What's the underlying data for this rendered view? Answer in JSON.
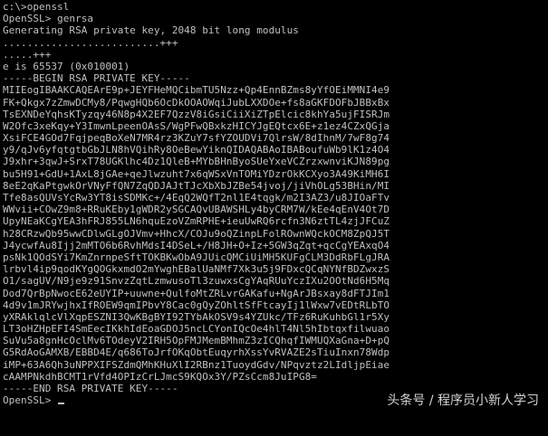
{
  "terminal": {
    "lines": [
      "c:\\>openssl",
      "OpenSSL> genrsa",
      "Generating RSA private key, 2048 bit long modulus",
      "..........................+++",
      ".....+++",
      "e is 65537 (0x010001)",
      "-----BEGIN RSA PRIVATE KEY-----",
      "MIIEogIBAAKCAQEArE9p+JEYFHeMQCibmTU5Nzz+Qp4EnnBZms8yYfOEiMMNI4e9",
      "FK+Qkgx7zZmwDCMy8/PqwgHQb6OcDkOOAOWqiJubLXXDOe+fs8aGKFDOFbJBBxBx",
      "TsEXNDeYqhsKTyzqy46N8p4X2EF7QzzV8iGsiCiiXiZTpElcic8khYa5ujFISRJm",
      "W2Ofc3xeKqy+Y3ImwnLpeenOAsS/WgPFwQBxkzHICYJgEQtcx6E+z1ez4CZxQGja",
      "XsiFCE4GOd7FqjpeqBoXeN7MR4rz3KZuY7sfYZOUDVi7QlrsW/8dIhnM/7wF8g74",
      "y9/qJv6yfqtgtbGbJLN8hVQihRy8OeBewYiknQIDAQABAoIBABoufuWb9lK1z4O4",
      "J9xhr+3qwJ+SrxT78UGKlhc4Dz1QleB+MYbBHnByoSUeYxeVCZrzxwnviKJN89pg",
      "bu5H91+GdU+1AxL8jGAe+qeJlwzuht7x6qWSxVnTOMiYDzrOkKCXyo3A49KiMH6I",
      "8eE2qKaPtgwkOrVNyFfQN7ZqQDJAJtTJcXbXbJZBe54jvoj/jiVhOLg53BHin/MI",
      "Tfe8asQUVsYcRw3YT8isSDMKc+/4EqQ2WQfT2nl1E4tqgk/m2I3AZ3/u8JIOaFTv",
      "WWvii+COwZ9m8+RRuKEby1gWDR2ySGCAQvUBAWSHLy4byCRM7W/kEe4qEnV4Ot7D",
      "UpyNEaKCgYEA3hFRJ855LN6hquEzoVZmRPHE+ieuUwRQ6rcfn3N6ztTL4zjJFCuZ",
      "h28CRzwQb95wwCDlwGLgOJVmv+HhcX/COJu9oQZinpLFolROwnWQckOCM8ZpQJ5T",
      "J4ycwfAu8Ijj2mMTO6b6RvhMdsI4DSeL+/H8JH+O+Iz+5GW3qZqt+qcCgYEAxqO4",
      "psNk1QOdSYi7KmZnrnpeSftTOKBKwObA9JUicQMCiUiMH5KUFgCLM3DdRbFLgJRA",
      "lrbvl4ip9qodKYgQOGkxmdO2mYwghEBalUaNMf7Xk3u5j9FDxcQCqNYNfBDZwxzS",
      "O1/sagUV/N9je9z91SnvzZqtLzmwusoTl3zuwxsCgYAqRUuYczIXu2OOtNd6H5Mq",
      "Dod7QrBpNwocE62eUYIP+uuwne+QulfoMtZRLvrGAKafu+NgArJBsxay8dFTJIm1",
      "4d9v1mJRYwjhxIfROEW9qmIPbvY8Cac0gQyZOhltSfFtcayIj1lWxw7vEDtRLbTO",
      "yXRAklqlcVlXqpESZNI3QwKBgBYI92TYbAkOSV9s4YZUkc/TFz6RuKuhbGl1r5Xy",
      "LT3oHZHpEFI4SmEecIKkhIdEoaGDOJ5ncLCYonIQcOe4hlT4Nl5hIbtqxfilwuao",
      "SuVu5a8gnHcOclMv6TOdeyV2IRH5OpFMJMemBMhmZ3zICQhqfIWMUQXaGna+D+pQ",
      "G5RdAoGAMXB/EBBD4E/q686ToJrfOKqObtEuqyrhXssYvRVAZE2sTiuInxn78Wdp",
      "iMP+63A6Qh3uNPPXIFSZdmQMhKHuXlI2RBnz1TuoydGdv/NPqvztz2LIdljpEiae",
      "cAAMPNkdhBCMT1rVfd4OPIzCrLJmcS9KQOx3Y/PZsCcm8JuIPG8=",
      "-----END RSA PRIVATE KEY-----",
      "OpenSSL> "
    ]
  },
  "watermark": {
    "text": "头条号 / 程序员小新人学习"
  },
  "colors": {
    "background": "#000000",
    "foreground": "#c0c0c0"
  }
}
